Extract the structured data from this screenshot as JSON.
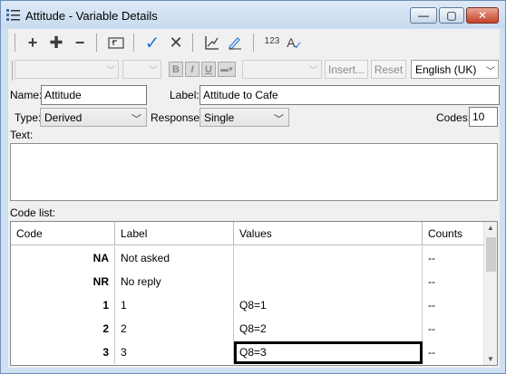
{
  "window": {
    "title": "Attitude - Variable Details",
    "min_symbol": "—",
    "max_symbol": "▢",
    "close_symbol": "✕"
  },
  "toolbar": {
    "plus": "+",
    "plus_multi": "✚",
    "minus": "−",
    "check": "✓",
    "cross": "✕",
    "numbers_label": "123",
    "spellcheck_label": "A"
  },
  "format_bar": {
    "bold": "B",
    "italic": "I",
    "underline": "U",
    "insert_label": "Insert...",
    "reset_label": "Reset",
    "language": "English (UK)"
  },
  "form": {
    "name_label": "Name:",
    "name_value": "Attitude",
    "label_label": "Label:",
    "label_value": "Attitude to Cafe",
    "type_label": "Type:",
    "type_value": "Derived",
    "response_label": "Response:",
    "response_value": "Single",
    "codes_label": "Codes:",
    "codes_value": "10",
    "text_label": "Text:",
    "code_list_label": "Code list:"
  },
  "grid": {
    "columns": [
      "Code",
      "Label",
      "Values",
      "Counts"
    ],
    "rows": [
      {
        "code": "NA",
        "label": "Not asked",
        "values": "",
        "counts": "--"
      },
      {
        "code": "NR",
        "label": "No reply",
        "values": "",
        "counts": "--"
      },
      {
        "code": "1",
        "label": "1",
        "values": "Q8=1",
        "counts": "--"
      },
      {
        "code": "2",
        "label": "2",
        "values": "Q8=2",
        "counts": "--"
      },
      {
        "code": "3",
        "label": "3",
        "values": "Q8=3",
        "counts": "--"
      }
    ]
  }
}
